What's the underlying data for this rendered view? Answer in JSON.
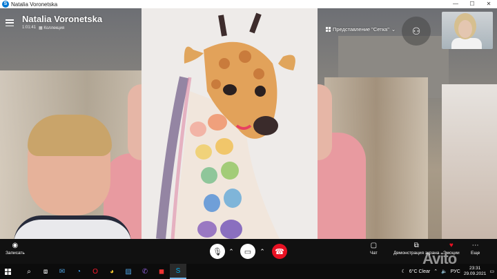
{
  "window": {
    "title": "Natalia Voronetska"
  },
  "call": {
    "caller_name": "Natalia Voronetska",
    "duration": "1:01:41",
    "collection_label": "Коллекция",
    "view_label": "Представление \"Сетка\""
  },
  "controls": {
    "record_label": "Записать",
    "chat_label": "Чат",
    "share_label": "Демонстрация экрана",
    "reactions_label": "Эмоции",
    "more_label": "Еще"
  },
  "taskbar": {
    "weather": "6°C  Clear",
    "language": "РУС",
    "time": "23:31",
    "date": "29.09.2021"
  },
  "watermark": "Avito",
  "colors": {
    "hangup": "#e81123",
    "accent": "#0078d4"
  }
}
